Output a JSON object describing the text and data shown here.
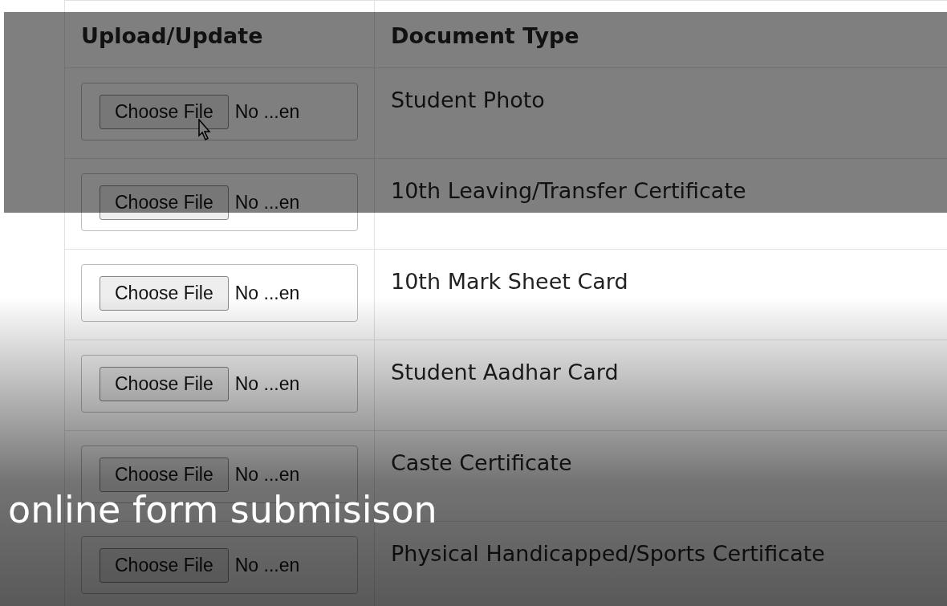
{
  "table": {
    "columns": [
      "Upload/Update",
      "Document Type"
    ],
    "rows": [
      {
        "button": "Choose File",
        "file_status": "No ...en",
        "document_type": "Student Photo"
      },
      {
        "button": "Choose File",
        "file_status": "No ...en",
        "document_type": "10th Leaving/Transfer Certificate"
      },
      {
        "button": "Choose File",
        "file_status": "No ...en",
        "document_type": "10th Mark Sheet Card"
      },
      {
        "button": "Choose File",
        "file_status": "No ...en",
        "document_type": "Student Aadhar Card"
      },
      {
        "button": "Choose File",
        "file_status": "No ...en",
        "document_type": "Caste Certificate"
      },
      {
        "button": "Choose File",
        "file_status": "No ...en",
        "document_type": "Physical Handicapped/Sports Certificate"
      }
    ]
  },
  "caption": "online form submisison"
}
